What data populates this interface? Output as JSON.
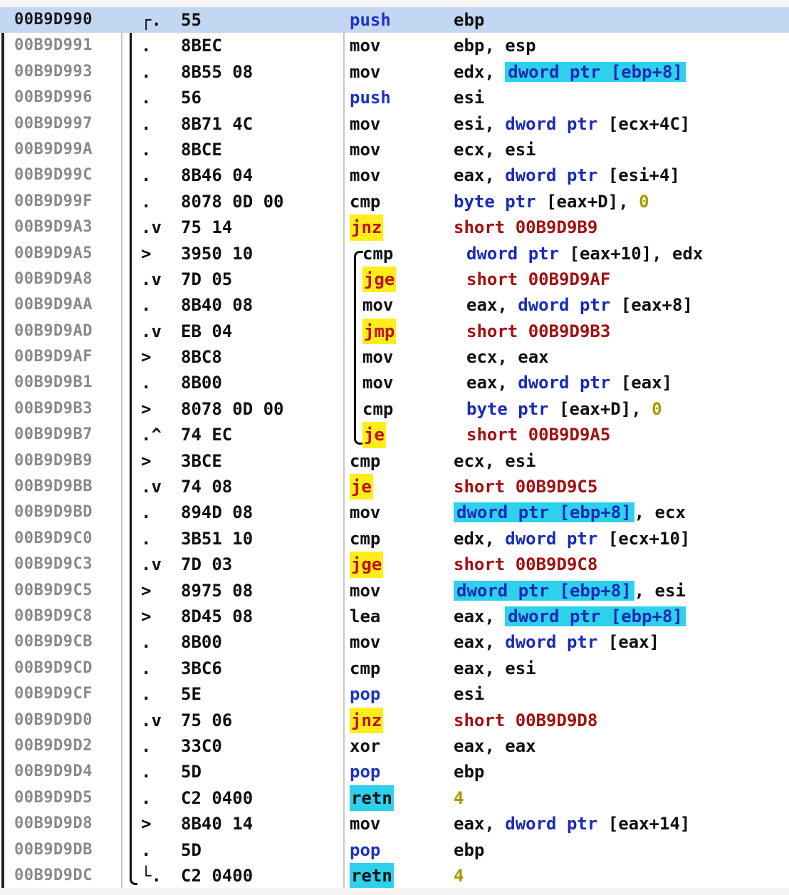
{
  "selected_address": "00B9D990",
  "rows": [
    {
      "addr": "00B9D990",
      "mark": "┌.",
      "hex": "55",
      "mnem": "push",
      "ops": "ebp"
    },
    {
      "addr": "00B9D991",
      "mark": ".",
      "hex": "8BEC",
      "mnem": "mov",
      "ops": "ebp, esp"
    },
    {
      "addr": "00B9D993",
      "mark": ".",
      "hex": "8B55 08",
      "mnem": "mov",
      "ops": "edx, dword ptr [ebp+8]"
    },
    {
      "addr": "00B9D996",
      "mark": ".",
      "hex": "56",
      "mnem": "push",
      "ops": "esi"
    },
    {
      "addr": "00B9D997",
      "mark": ".",
      "hex": "8B71 4C",
      "mnem": "mov",
      "ops": "esi, dword ptr [ecx+4C]"
    },
    {
      "addr": "00B9D99A",
      "mark": ".",
      "hex": "8BCE",
      "mnem": "mov",
      "ops": "ecx, esi"
    },
    {
      "addr": "00B9D99C",
      "mark": ".",
      "hex": "8B46 04",
      "mnem": "mov",
      "ops": "eax, dword ptr [esi+4]"
    },
    {
      "addr": "00B9D99F",
      "mark": ".",
      "hex": "8078 0D 00",
      "mnem": "cmp",
      "ops": "byte ptr [eax+D], 0"
    },
    {
      "addr": "00B9D9A3",
      "mark": ".v",
      "hex": "75 14",
      "mnem": "jnz",
      "ops": "short 00B9D9B9"
    },
    {
      "addr": "00B9D9A5",
      "mark": ">",
      "hex": "3950 10",
      "mnem": "cmp",
      "ops": "dword ptr [eax+10], edx"
    },
    {
      "addr": "00B9D9A8",
      "mark": ".v",
      "hex": "7D 05",
      "mnem": "jge",
      "ops": "short 00B9D9AF"
    },
    {
      "addr": "00B9D9AA",
      "mark": ".",
      "hex": "8B40 08",
      "mnem": "mov",
      "ops": "eax, dword ptr [eax+8]"
    },
    {
      "addr": "00B9D9AD",
      "mark": ".v",
      "hex": "EB 04",
      "mnem": "jmp",
      "ops": "short 00B9D9B3"
    },
    {
      "addr": "00B9D9AF",
      "mark": ">",
      "hex": "8BC8",
      "mnem": "mov",
      "ops": "ecx, eax"
    },
    {
      "addr": "00B9D9B1",
      "mark": ".",
      "hex": "8B00",
      "mnem": "mov",
      "ops": "eax, dword ptr [eax]"
    },
    {
      "addr": "00B9D9B3",
      "mark": ">",
      "hex": "8078 0D 00",
      "mnem": "cmp",
      "ops": "byte ptr [eax+D], 0"
    },
    {
      "addr": "00B9D9B7",
      "mark": ".^",
      "hex": "74 EC",
      "mnem": "je",
      "ops": "short 00B9D9A5"
    },
    {
      "addr": "00B9D9B9",
      "mark": ">",
      "hex": "3BCE",
      "mnem": "cmp",
      "ops": "ecx, esi"
    },
    {
      "addr": "00B9D9BB",
      "mark": ".v",
      "hex": "74 08",
      "mnem": "je",
      "ops": "short 00B9D9C5"
    },
    {
      "addr": "00B9D9BD",
      "mark": ".",
      "hex": "894D 08",
      "mnem": "mov",
      "ops": "dword ptr [ebp+8], ecx"
    },
    {
      "addr": "00B9D9C0",
      "mark": ".",
      "hex": "3B51 10",
      "mnem": "cmp",
      "ops": "edx, dword ptr [ecx+10]"
    },
    {
      "addr": "00B9D9C3",
      "mark": ".v",
      "hex": "7D 03",
      "mnem": "jge",
      "ops": "short 00B9D9C8"
    },
    {
      "addr": "00B9D9C5",
      "mark": ">",
      "hex": "8975 08",
      "mnem": "mov",
      "ops": "dword ptr [ebp+8], esi"
    },
    {
      "addr": "00B9D9C8",
      "mark": ">",
      "hex": "8D45 08",
      "mnem": "lea",
      "ops": "eax, dword ptr [ebp+8]"
    },
    {
      "addr": "00B9D9CB",
      "mark": ".",
      "hex": "8B00",
      "mnem": "mov",
      "ops": "eax, dword ptr [eax]"
    },
    {
      "addr": "00B9D9CD",
      "mark": ".",
      "hex": "3BC6",
      "mnem": "cmp",
      "ops": "eax, esi"
    },
    {
      "addr": "00B9D9CF",
      "mark": ".",
      "hex": "5E",
      "mnem": "pop",
      "ops": "esi"
    },
    {
      "addr": "00B9D9D0",
      "mark": ".v",
      "hex": "75 06",
      "mnem": "jnz",
      "ops": "short 00B9D9D8"
    },
    {
      "addr": "00B9D9D2",
      "mark": ".",
      "hex": "33C0",
      "mnem": "xor",
      "ops": "eax, eax"
    },
    {
      "addr": "00B9D9D4",
      "mark": ".",
      "hex": "5D",
      "mnem": "pop",
      "ops": "ebp"
    },
    {
      "addr": "00B9D9D5",
      "mark": ".",
      "hex": "C2 0400",
      "mnem": "retn",
      "ops": "4"
    },
    {
      "addr": "00B9D9D8",
      "mark": ">",
      "hex": "8B40 14",
      "mnem": "mov",
      "ops": "eax, dword ptr [eax+14]"
    },
    {
      "addr": "00B9D9DB",
      "mark": ".",
      "hex": "5D",
      "mnem": "pop",
      "ops": "ebp"
    },
    {
      "addr": "00B9D9DC",
      "mark": "└.",
      "hex": "C2 0400",
      "mnem": "retn",
      "ops": "4"
    }
  ],
  "colors": {
    "selection": "#c4d7f2",
    "jump_highlight": "#ffee1a",
    "ret_and_memory_highlight": "#2dd1ec",
    "stack_op": "#1c33c8",
    "jump_target": "#a31010"
  }
}
